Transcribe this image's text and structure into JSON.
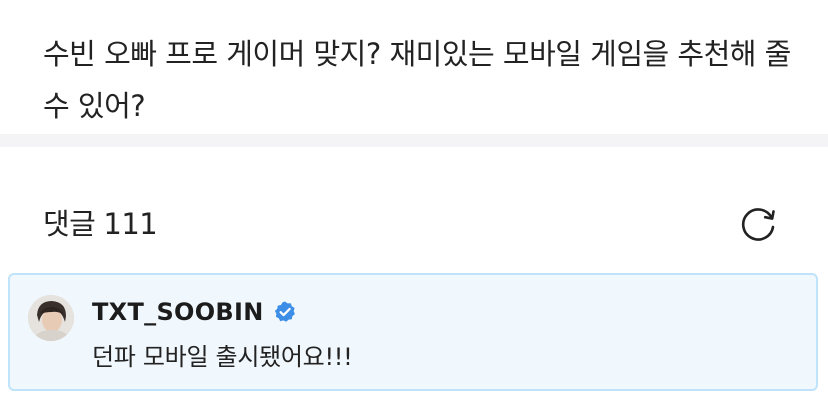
{
  "post": {
    "text": "수빈 오빠 프로 게이머 맞지? 재미있는 모바일 게임을 추천해 줄 수 있어?"
  },
  "comments": {
    "label": "댓글",
    "count": "111",
    "refresh_icon": "refresh-icon"
  },
  "pinned_reply": {
    "author": "TXT_SOOBIN",
    "verified_icon": "verified-badge-icon",
    "text": "던파 모바일 출시됐어요!!!",
    "card_background": "#f1f8fd",
    "card_border": "#bfe3fa",
    "badge_color": "#3d8ee6"
  }
}
